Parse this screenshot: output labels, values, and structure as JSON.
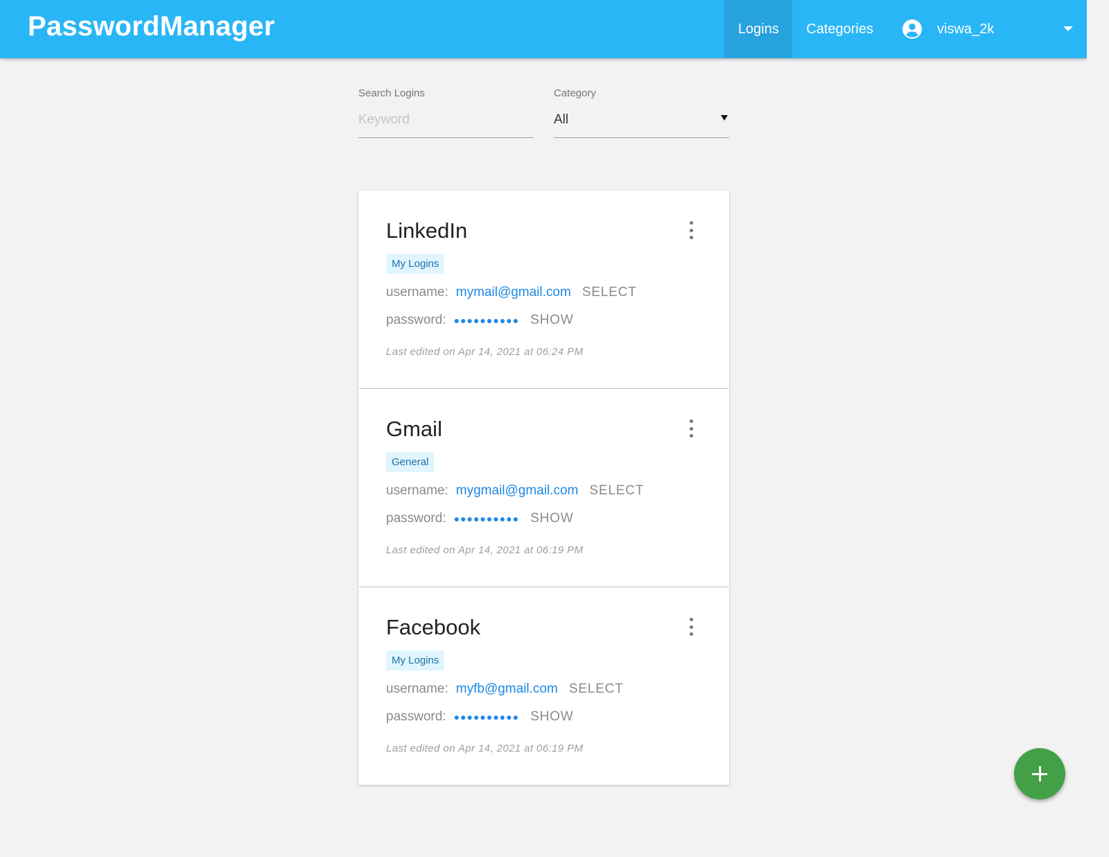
{
  "header": {
    "brand": "PasswordManager",
    "nav": [
      {
        "label": "Logins",
        "active": true
      },
      {
        "label": "Categories",
        "active": false
      }
    ],
    "user": {
      "name": "viswa_2k",
      "icon": "account-circle-icon"
    }
  },
  "filters": {
    "search": {
      "label": "Search Logins",
      "placeholder": "Keyword",
      "value": ""
    },
    "category": {
      "label": "Category",
      "selected": "All"
    }
  },
  "logins": [
    {
      "title": "LinkedIn",
      "category": "My Logins",
      "username_label": "username:",
      "username": "mymail@gmail.com",
      "select_label": "SELECT",
      "password_label": "password:",
      "password_mask": "●●●●●●●●●●",
      "show_label": "SHOW",
      "edited": "Last edited on Apr 14, 2021 at 06:24 PM"
    },
    {
      "title": "Gmail",
      "category": "General",
      "username_label": "username:",
      "username": "mygmail@gmail.com",
      "select_label": "SELECT",
      "password_label": "password:",
      "password_mask": "●●●●●●●●●●",
      "show_label": "SHOW",
      "edited": "Last edited on Apr 14, 2021 at 06:19 PM"
    },
    {
      "title": "Facebook",
      "category": "My Logins",
      "username_label": "username:",
      "username": "myfb@gmail.com",
      "select_label": "SELECT",
      "password_label": "password:",
      "password_mask": "●●●●●●●●●●",
      "show_label": "SHOW",
      "edited": "Last edited on Apr 14, 2021 at 06:19 PM"
    }
  ],
  "fab": {
    "icon": "plus-icon"
  },
  "colors": {
    "appbar": "#29b6f6",
    "appbar_active": "#26a2de",
    "link": "#1e88e5",
    "chip_bg": "#e1f5fe",
    "fab": "#43a047",
    "background": "#f2f2f2"
  }
}
